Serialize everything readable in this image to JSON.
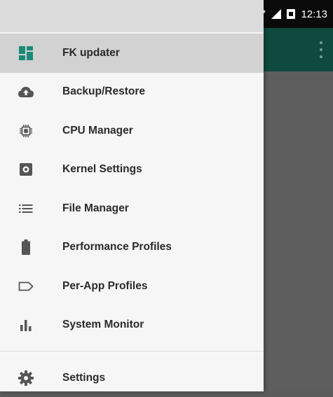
{
  "status_bar": {
    "time": "12:13"
  },
  "drawer": {
    "items": [
      {
        "label": "FK updater",
        "icon": "dashboard-icon",
        "active": true
      },
      {
        "label": "Backup/Restore",
        "icon": "cloud-upload-icon"
      },
      {
        "label": "CPU Manager",
        "icon": "cpu-chip-icon"
      },
      {
        "label": "Kernel Settings",
        "icon": "kernel-settings-icon"
      },
      {
        "label": "File Manager",
        "icon": "list-icon"
      },
      {
        "label": "Performance Profiles",
        "icon": "battery-icon"
      },
      {
        "label": "Per-App Profiles",
        "icon": "label-tag-icon"
      },
      {
        "label": "System Monitor",
        "icon": "bar-chart-icon"
      }
    ],
    "settings": {
      "label": "Settings",
      "icon": "gear-icon"
    }
  },
  "colors": {
    "appbar": "#0f4a3e",
    "drawer_bg": "#f6f6f6",
    "active_item_bg": "#d2d2d2",
    "accent_icon": "#1b8a78",
    "icon_gray": "#555555"
  }
}
